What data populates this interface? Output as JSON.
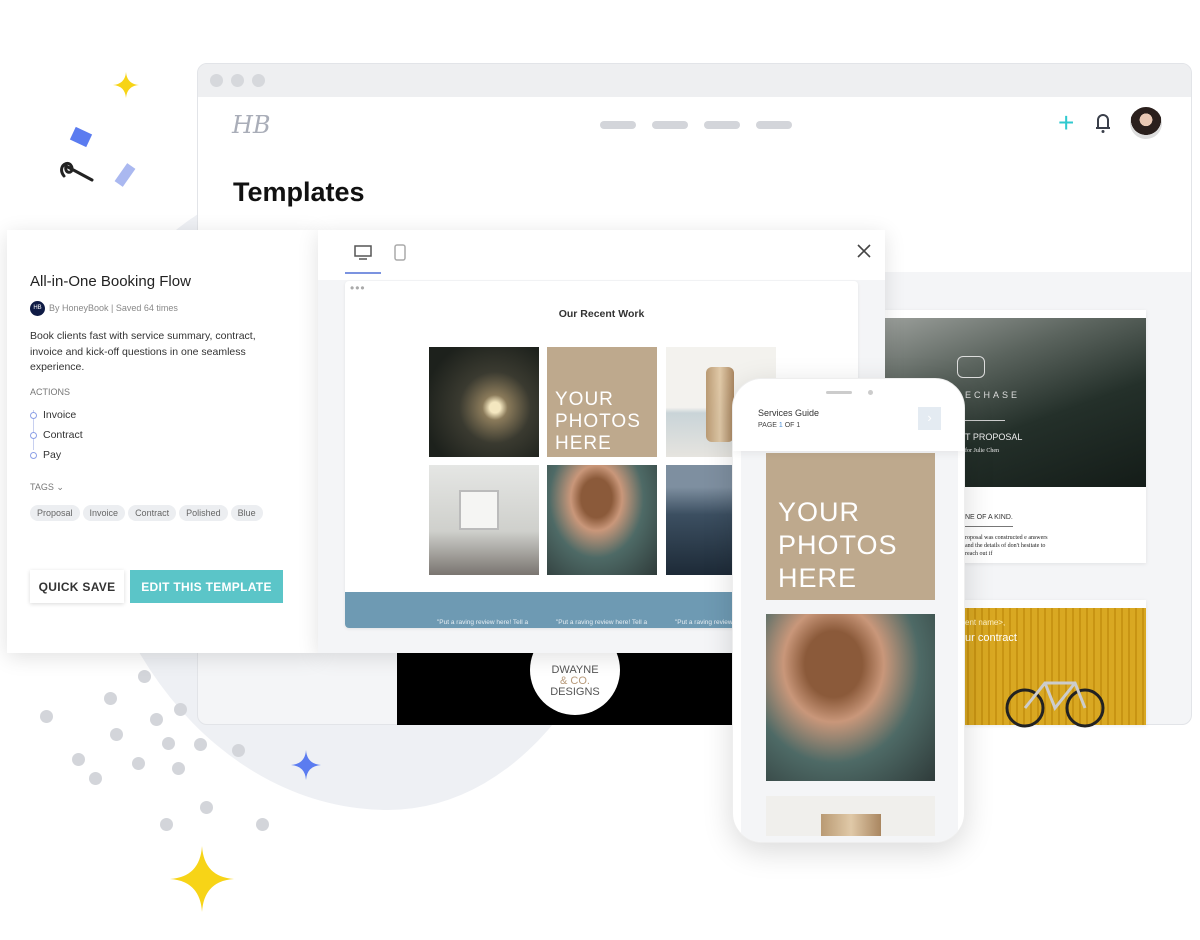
{
  "app": {
    "logo": "HB",
    "page_title": "Templates",
    "nav_items": [
      "",
      "",
      "",
      ""
    ]
  },
  "colors": {
    "accent": "#5bc5c8",
    "plus": "#2fc9cf",
    "review_band": "#6e9ab3",
    "photo_placeholder": "#bea98d",
    "star_yellow": "#f7d417",
    "star_blue": "#5b7cf0"
  },
  "template": {
    "title": "All-in-One Booking Flow",
    "meta": "By HoneyBook | Saved 64 times",
    "description": "Book clients fast with service summary, contract, invoice and kick-off questions in one seamless experience.",
    "actions_label": "ACTIONS",
    "actions": [
      "Invoice",
      "Contract",
      "Pay"
    ],
    "tags_label": "TAGS",
    "tags": [
      "Proposal",
      "Invoice",
      "Contract",
      "Polished",
      "Blue"
    ],
    "quick_save": "QUICK SAVE",
    "edit": "EDIT THIS TEMPLATE"
  },
  "preview": {
    "heading": "Our Recent Work",
    "placeholder": "YOUR PHOTOS HERE",
    "reviews": [
      "\"Put a raving review here! Tell a",
      "\"Put a raving review here! Tell a",
      "\"Put a raving review"
    ]
  },
  "phone": {
    "title": "Services Guide",
    "page_prefix": "PAGE ",
    "page_current": "1",
    "page_suffix": " OF 1",
    "placeholder": "YOUR PHOTOS HERE"
  },
  "bg_cards": {
    "card1": {
      "brand": "ECHASE",
      "title": "T PROPOSAL",
      "subtitle": "for Julie Chen",
      "heading": "NE OF A KIND.",
      "body": "roposal was constructed e answers and the details of don't hesitate to reach out if"
    },
    "card2": {
      "line1": "ent name>,",
      "line2": "ur contract"
    },
    "card3": {
      "logo_lines": [
        "DWAYNE",
        "& CO.",
        "DESIGNS"
      ]
    }
  }
}
